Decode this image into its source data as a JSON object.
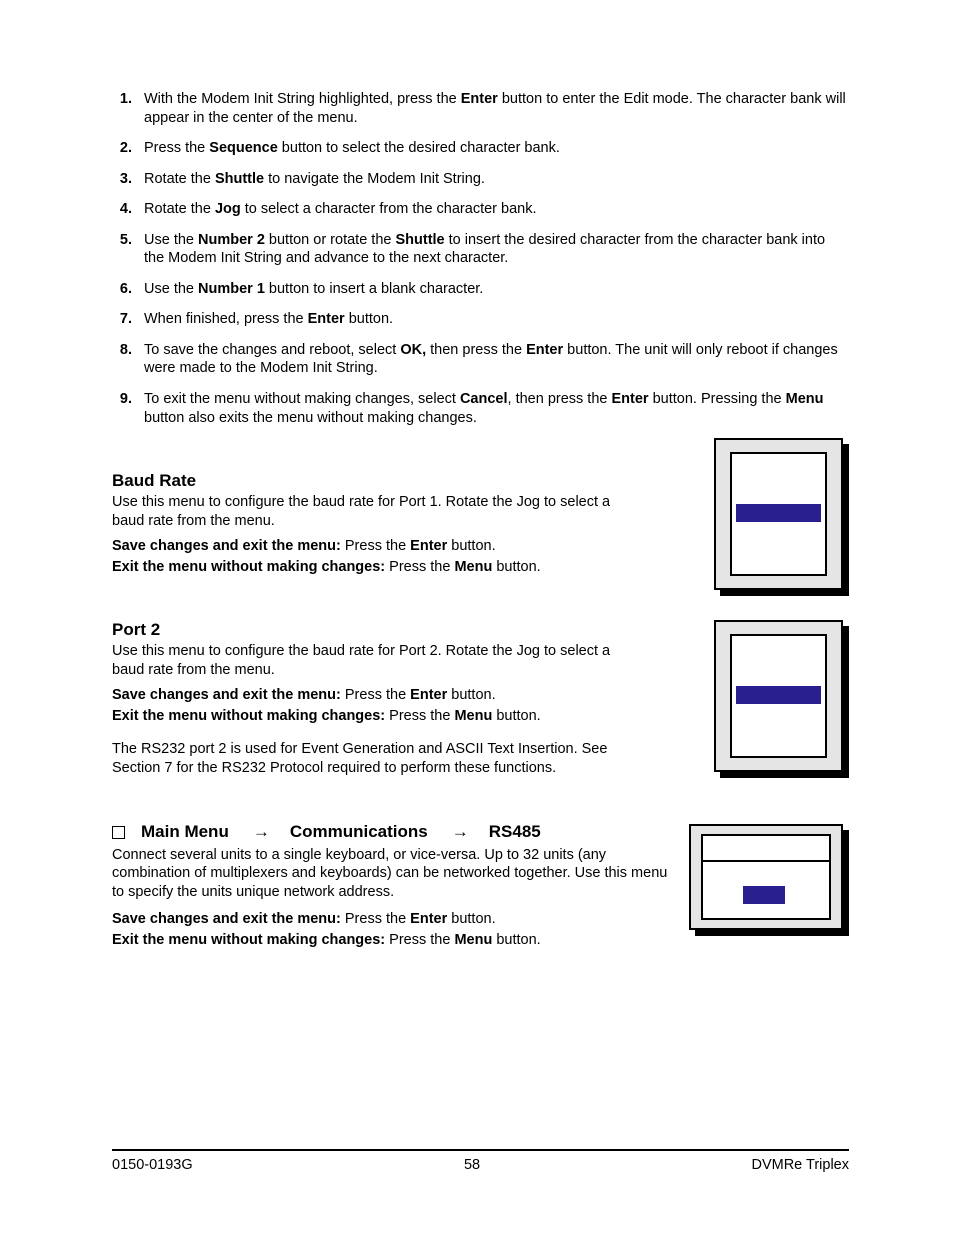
{
  "steps": [
    {
      "n": "1.",
      "html": "With the Modem Init String highlighted, press the <b>Enter</b> button to enter the Edit mode.  The character bank will appear in the center of the menu."
    },
    {
      "n": "2.",
      "html": "Press the <b>Sequence</b> button to select the desired character bank."
    },
    {
      "n": "3.",
      "html": "Rotate the <b>Shuttle</b> to navigate the Modem Init String."
    },
    {
      "n": "4.",
      "html": "Rotate the <b>Jog</b> to select a character from the character bank."
    },
    {
      "n": "5.",
      "html": "Use the <b>Number 2</b> button or rotate the <b>Shuttle</b> to insert the desired character from the character bank into the Modem Init String and advance to the next character."
    },
    {
      "n": "6.",
      "html": "Use the <b>Number 1</b> button to insert a blank character."
    },
    {
      "n": "7.",
      "html": "When finished, press the <b>Enter</b> button."
    },
    {
      "n": "8.",
      "html": "To save the changes and reboot, select <b>OK,</b> then press the <b>Enter</b> button.  The unit will only reboot if changes were made to the Modem Init String."
    },
    {
      "n": "9.",
      "html": "To exit the menu without making changes, select <b>Cancel</b>, then press the <b>Enter</b> button.  Pressing the <b>Menu</b> button also exits the menu without making changes."
    }
  ],
  "baud": {
    "title": "Baud Rate",
    "p1": "Use this menu to configure the baud rate for Port 1.  Rotate the Jog to select a baud rate from the menu.",
    "save_html": "<b>Save changes and exit the menu:</b>  Press the <b>Enter</b> button.",
    "exit_html": "<b>Exit the menu without making changes:</b>  Press the <b>Menu</b> button."
  },
  "port2": {
    "title": "Port 2",
    "p1": "Use this menu to configure the baud rate for Port 2.  Rotate the Jog to select a baud rate from the menu.",
    "save_html": "<b>Save changes and exit the menu:</b>  Press the <b>Enter</b> button.",
    "exit_html": "<b>Exit the menu without making changes:</b>  Press the <b>Menu</b> button.",
    "p2": "The RS232 port 2 is used for Event Generation and ASCII Text Insertion. See Section 7 for the RS232 Protocol required to perform these functions."
  },
  "rs485": {
    "head": {
      "seg1": "Main Menu",
      "seg2": "Communications",
      "seg3": "RS485"
    },
    "p1": "Connect several units to a single keyboard, or vice-versa.  Up to 32 units (any combination of multiplexers and keyboards) can be networked together.  Use this menu to specify the units unique network address.",
    "save_html": "<b>Save changes and exit the menu:</b>  Press the <b>Enter</b> button.",
    "exit_html": "<b>Exit the menu without making changes:</b>  Press the <b>Menu</b> button."
  },
  "footer": {
    "left": "0150-0193G",
    "center": "58",
    "right": "DVMRe Triplex"
  }
}
